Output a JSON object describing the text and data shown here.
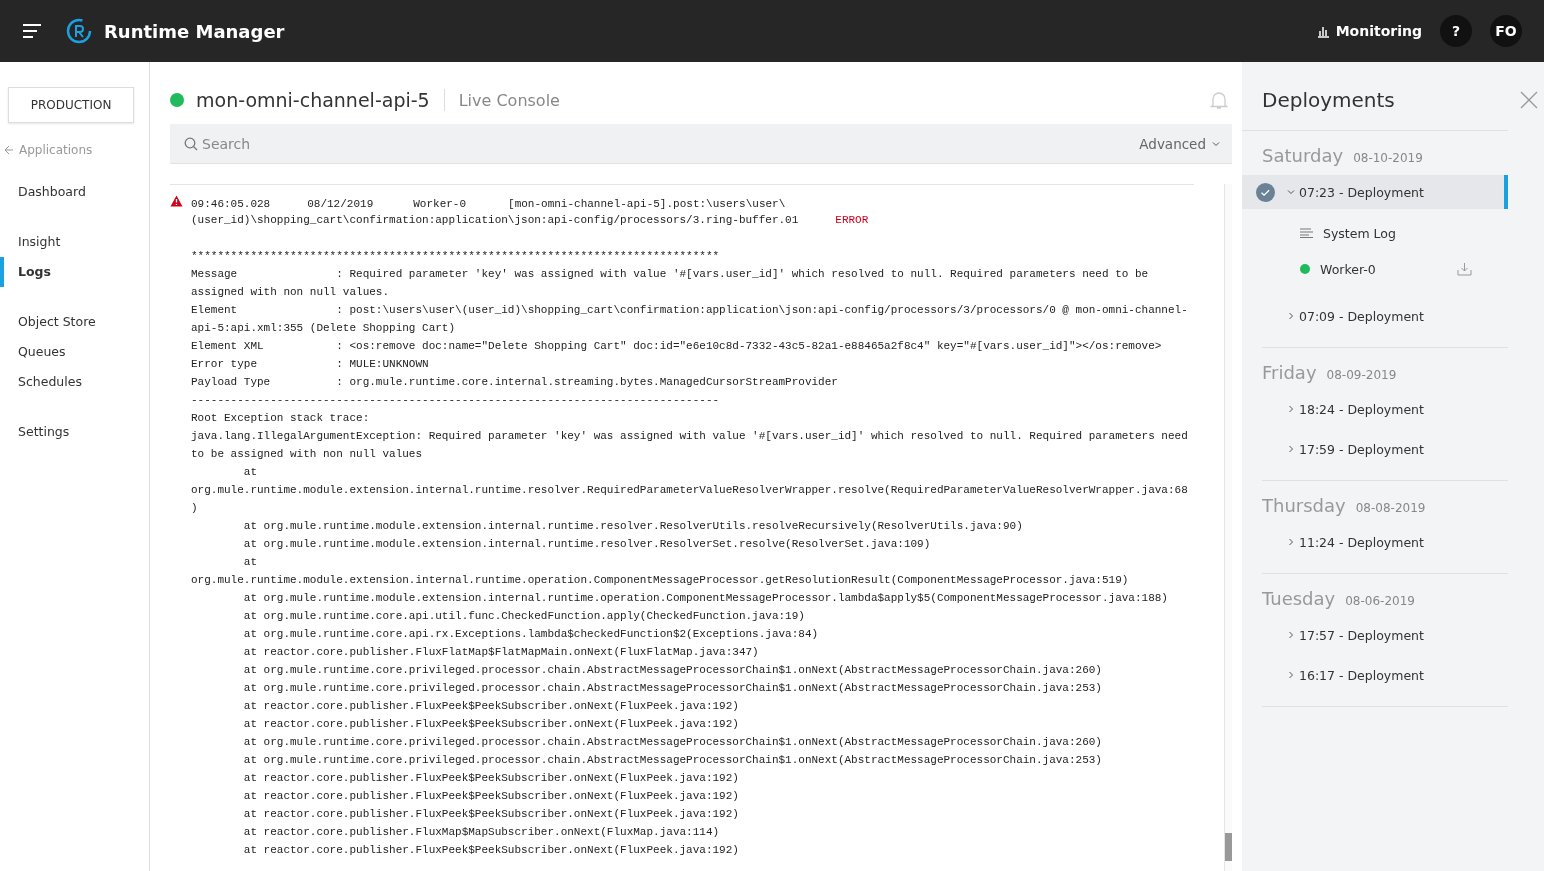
{
  "header": {
    "title": "Runtime Manager",
    "monitoring": "Monitoring",
    "help": "?",
    "avatar": "FO"
  },
  "environment": "PRODUCTION",
  "back_link": "Applications",
  "nav": [
    {
      "items": [
        {
          "label": "Dashboard",
          "selected": false
        }
      ]
    },
    {
      "items": [
        {
          "label": "Insight",
          "selected": false
        },
        {
          "label": "Logs",
          "selected": true
        }
      ]
    },
    {
      "items": [
        {
          "label": "Object Store",
          "selected": false
        },
        {
          "label": "Queues",
          "selected": false
        },
        {
          "label": "Schedules",
          "selected": false
        }
      ]
    },
    {
      "items": [
        {
          "label": "Settings",
          "selected": false
        }
      ]
    }
  ],
  "app": {
    "name": "mon-omni-channel-api-5",
    "running": true,
    "view": "Live Console"
  },
  "search": {
    "placeholder": "Search",
    "advanced": "Advanced"
  },
  "log": {
    "time": "09:46:05.028",
    "date": "08/12/2019",
    "worker": "Worker-0",
    "source": [
      "[mon-omni-channel-api-5].post:\\users\\user\\",
      "(user_id)\\shopping_cart\\confirmation:application\\json:api-config/processors/3.ring-buffer.01"
    ],
    "level": "ERROR",
    "lines": [
      "********************************************************************************",
      "Message               : Required parameter 'key' was assigned with value '#[vars.user_id]' which resolved to null. Required parameters need to be",
      "assigned with non null values.",
      "Element               : post:\\users\\user\\(user_id)\\shopping_cart\\confirmation:application\\json:api-config/processors/3/processors/0 @ mon-omni-channel-",
      "api-5:api.xml:355 (Delete Shopping Cart)",
      "Element XML           : <os:remove doc:name=\"Delete Shopping Cart\" doc:id=\"e6e10c8d-7332-43c5-82a1-e88465a2f8c4\" key=\"#[vars.user_id]\"></os:remove>",
      "Error type            : MULE:UNKNOWN",
      "Payload Type          : org.mule.runtime.core.internal.streaming.bytes.ManagedCursorStreamProvider",
      "--------------------------------------------------------------------------------",
      "Root Exception stack trace:",
      "java.lang.IllegalArgumentException: Required parameter 'key' was assigned with value '#[vars.user_id]' which resolved to null. Required parameters need",
      "to be assigned with non null values",
      "        at",
      "org.mule.runtime.module.extension.internal.runtime.resolver.RequiredParameterValueResolverWrapper.resolve(RequiredParameterValueResolverWrapper.java:68",
      ")",
      "        at org.mule.runtime.module.extension.internal.runtime.resolver.ResolverUtils.resolveRecursively(ResolverUtils.java:90)",
      "        at org.mule.runtime.module.extension.internal.runtime.resolver.ResolverSet.resolve(ResolverSet.java:109)",
      "        at",
      "org.mule.runtime.module.extension.internal.runtime.operation.ComponentMessageProcessor.getResolutionResult(ComponentMessageProcessor.java:519)",
      "        at org.mule.runtime.module.extension.internal.runtime.operation.ComponentMessageProcessor.lambda$apply$5(ComponentMessageProcessor.java:188)",
      "        at org.mule.runtime.core.api.util.func.CheckedFunction.apply(CheckedFunction.java:19)",
      "        at org.mule.runtime.core.api.rx.Exceptions.lambda$checkedFunction$2(Exceptions.java:84)",
      "        at reactor.core.publisher.FluxFlatMap$FlatMapMain.onNext(FluxFlatMap.java:347)",
      "        at org.mule.runtime.core.privileged.processor.chain.AbstractMessageProcessorChain$1.onNext(AbstractMessageProcessorChain.java:260)",
      "        at org.mule.runtime.core.privileged.processor.chain.AbstractMessageProcessorChain$1.onNext(AbstractMessageProcessorChain.java:253)",
      "        at reactor.core.publisher.FluxPeek$PeekSubscriber.onNext(FluxPeek.java:192)",
      "        at reactor.core.publisher.FluxPeek$PeekSubscriber.onNext(FluxPeek.java:192)",
      "        at org.mule.runtime.core.privileged.processor.chain.AbstractMessageProcessorChain$1.onNext(AbstractMessageProcessorChain.java:260)",
      "        at org.mule.runtime.core.privileged.processor.chain.AbstractMessageProcessorChain$1.onNext(AbstractMessageProcessorChain.java:253)",
      "        at reactor.core.publisher.FluxPeek$PeekSubscriber.onNext(FluxPeek.java:192)",
      "        at reactor.core.publisher.FluxPeek$PeekSubscriber.onNext(FluxPeek.java:192)",
      "        at reactor.core.publisher.FluxPeek$PeekSubscriber.onNext(FluxPeek.java:192)",
      "        at reactor.core.publisher.FluxMap$MapSubscriber.onNext(FluxMap.java:114)",
      "        at reactor.core.publisher.FluxPeek$PeekSubscriber.onNext(FluxPeek.java:192)"
    ]
  },
  "deployments": {
    "title": "Deployments",
    "days": [
      {
        "day": "Saturday",
        "date": "08-10-2019",
        "items": [
          {
            "label": "07:23 - Deployment",
            "selected": true,
            "expanded": true,
            "children": [
              {
                "kind": "log",
                "label": "System Log"
              },
              {
                "kind": "worker",
                "label": "Worker-0",
                "color": "#1fba5c"
              }
            ]
          },
          {
            "label": "07:09 - Deployment",
            "selected": false,
            "expanded": false
          }
        ]
      },
      {
        "day": "Friday",
        "date": "08-09-2019",
        "items": [
          {
            "label": "18:24 - Deployment",
            "selected": false,
            "expanded": false
          },
          {
            "label": "17:59 - Deployment",
            "selected": false,
            "expanded": false
          }
        ]
      },
      {
        "day": "Thursday",
        "date": "08-08-2019",
        "items": [
          {
            "label": "11:24 - Deployment",
            "selected": false,
            "expanded": false
          }
        ]
      },
      {
        "day": "Tuesday",
        "date": "08-06-2019",
        "items": [
          {
            "label": "17:57 - Deployment",
            "selected": false,
            "expanded": false
          },
          {
            "label": "16:17 - Deployment",
            "selected": false,
            "expanded": false
          }
        ]
      }
    ]
  }
}
